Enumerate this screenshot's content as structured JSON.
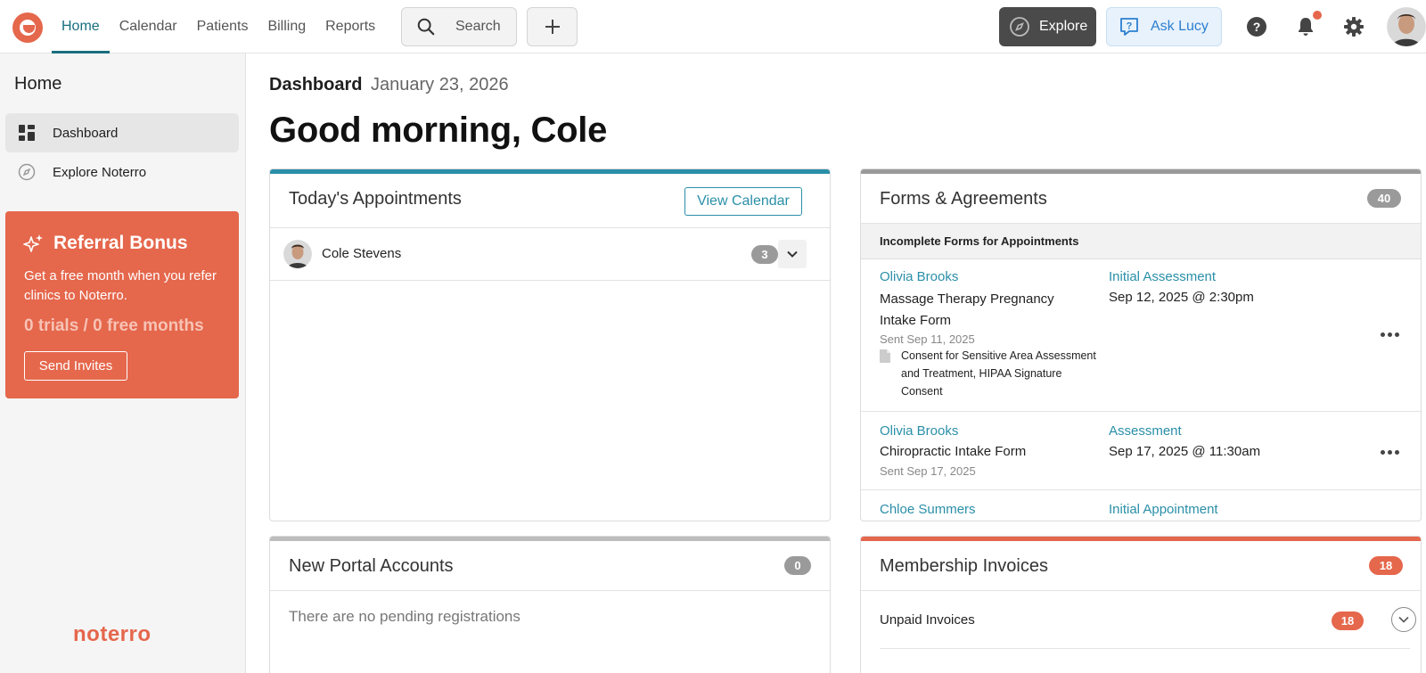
{
  "nav": {
    "items": [
      {
        "label": "Home",
        "active": true
      },
      {
        "label": "Calendar"
      },
      {
        "label": "Patients"
      },
      {
        "label": "Billing"
      },
      {
        "label": "Reports"
      }
    ],
    "search_label": "Search",
    "explore_label": "Explore",
    "ask_label": "Ask Lucy",
    "icons": [
      "search-icon",
      "plus-icon",
      "compass-icon",
      "chat-question-icon",
      "help-icon",
      "bell-icon",
      "gear-icon"
    ]
  },
  "sidebar": {
    "title": "Home",
    "items": [
      {
        "label": "Dashboard",
        "icon": "dashboard-icon",
        "active": true
      },
      {
        "label": "Explore Noterro",
        "icon": "compass-icon"
      }
    ],
    "referral": {
      "title": "Referral Bonus",
      "description": "Get a free month when you refer clinics to Noterro.",
      "stats": "0 trials / 0 free months",
      "button": "Send Invites"
    },
    "brand": "noterro"
  },
  "main": {
    "breadcrumb": "Dashboard",
    "date": "January 23, 2026",
    "greeting": "Good morning, Cole"
  },
  "appointments": {
    "title": "Today's Appointments",
    "view_calendar": "View Calendar",
    "rows": [
      {
        "name": "Cole Stevens",
        "count": "3"
      }
    ]
  },
  "forms": {
    "title": "Forms & Agreements",
    "count": "40",
    "subheader": "Incomplete Forms for Appointments",
    "entries": [
      {
        "patient": "Olivia Brooks",
        "form": "Massage Therapy Pregnancy Intake Form",
        "sent": "Sent Sep 11, 2025",
        "attachments": "Consent for Sensitive Area Assessment and Treatment, HIPAA Signature Consent",
        "appt_type": "Initial Assessment",
        "appt_date": "Sep 12, 2025 @ 2:30pm"
      },
      {
        "patient": "Olivia Brooks",
        "form": "Chiropractic Intake Form",
        "sent": "Sent Sep 17, 2025",
        "appt_type": "Assessment",
        "appt_date": "Sep 17, 2025 @ 11:30am"
      },
      {
        "patient": "Chloe Summers",
        "appt_type": "Initial Appointment"
      }
    ]
  },
  "portal": {
    "title": "New Portal Accounts",
    "count": "0",
    "empty": "There are no pending registrations"
  },
  "invoices": {
    "title": "Membership Invoices",
    "count": "18",
    "unpaid_label": "Unpaid Invoices",
    "unpaid_count": "18"
  },
  "colors": {
    "brand": "#e5674c",
    "teal": "#1a6e7e",
    "link": "#2a8fa8",
    "appointments_bar": "#2a8fa8",
    "forms_bar": "#9a9a9a",
    "portal_bar": "#bdbdbd",
    "invoices_bar": "#e5674c"
  }
}
